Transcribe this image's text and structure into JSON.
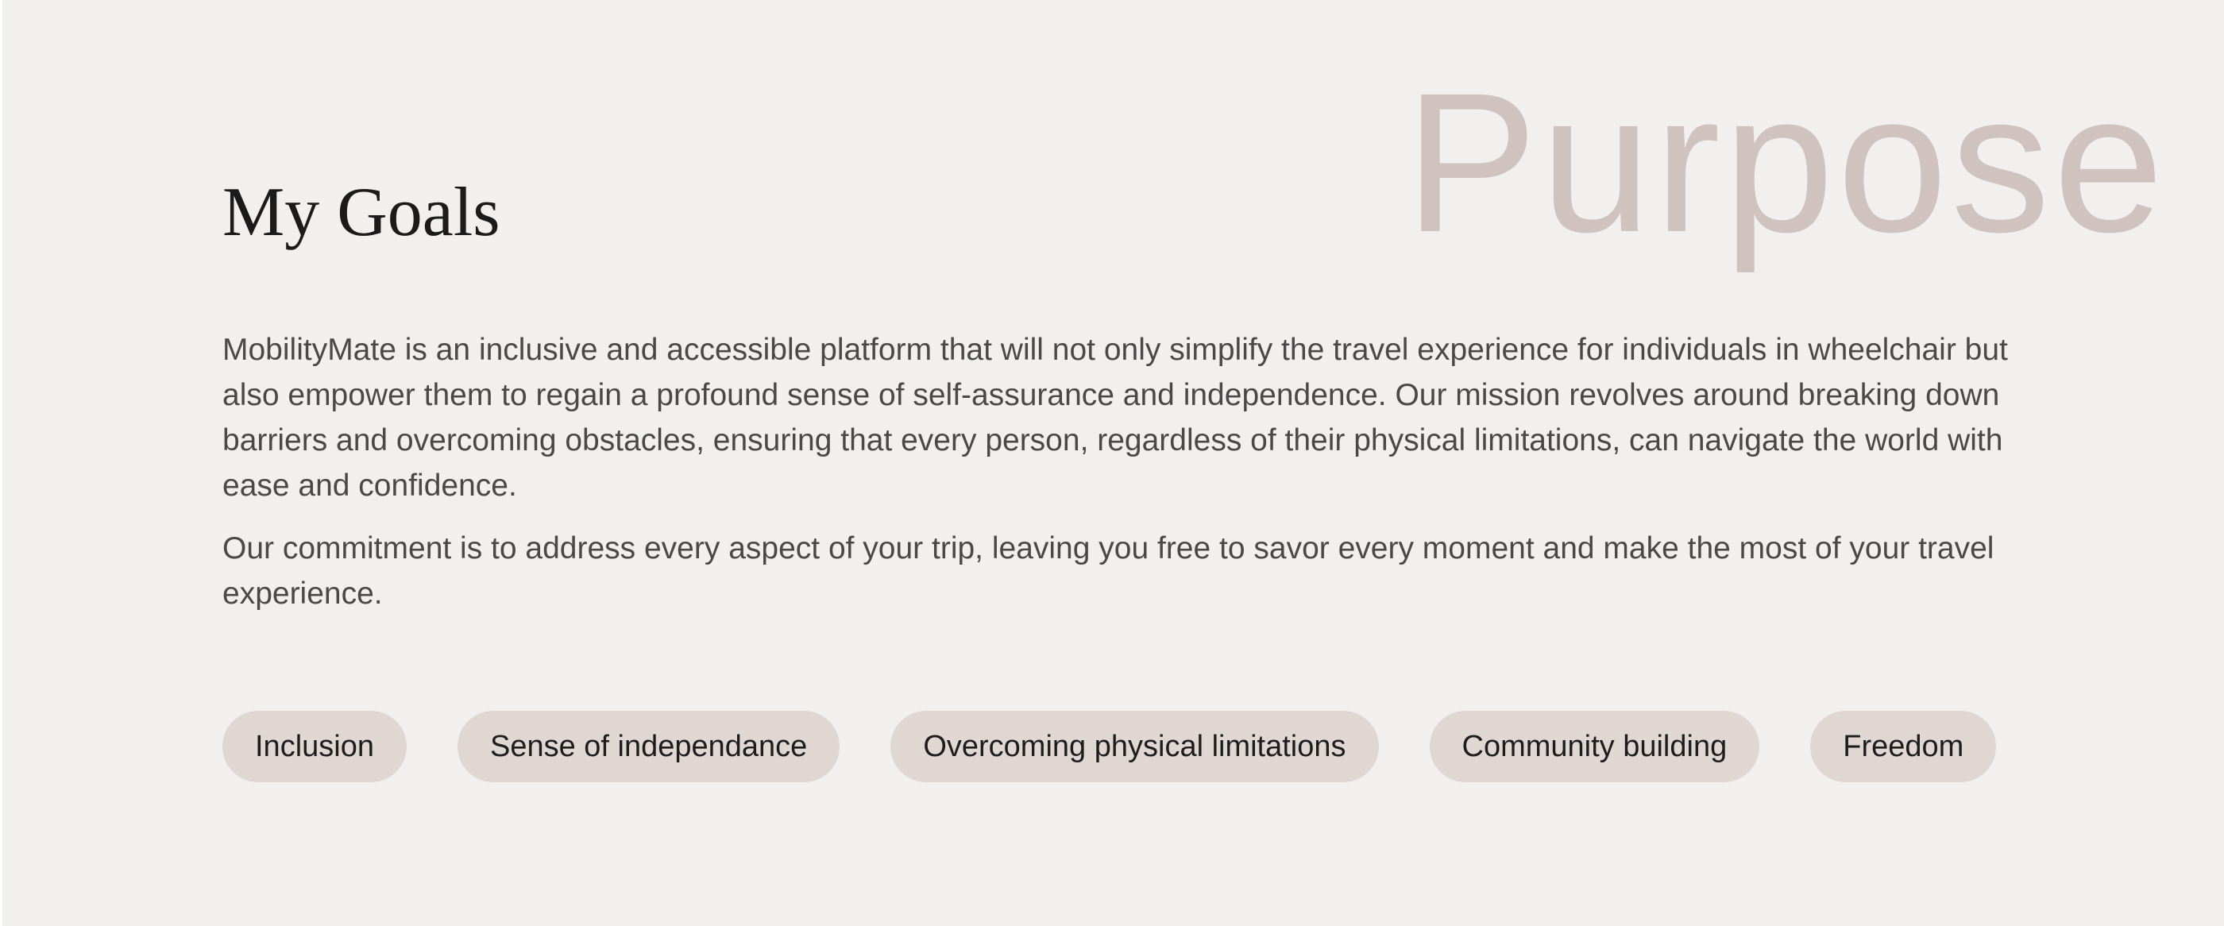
{
  "watermark": "Purpose",
  "section": {
    "title": "My Goals",
    "paragraphs": [
      "MobilityMate is an inclusive and accessible platform that will not only simplify the travel experience for individuals in wheelchair but also empower them to regain a profound sense of self-assurance and independence. Our mission revolves around breaking down barriers and overcoming obstacles, ensuring that every person, regardless of their physical limitations, can navigate the world with ease and confidence.",
      "Our commitment is to address every aspect of your trip, leaving you free to savor every moment and make the most of your travel experience."
    ]
  },
  "tags": [
    "Inclusion",
    "Sense of independance",
    "Overcoming physical limitations",
    "Community building",
    "Freedom"
  ],
  "colors": {
    "background": "#f1f0ee",
    "watermark": "#d0c3bf",
    "tag_background": "#e0d6d2",
    "title": "#1b1b1b",
    "body_text": "#4a4848"
  }
}
